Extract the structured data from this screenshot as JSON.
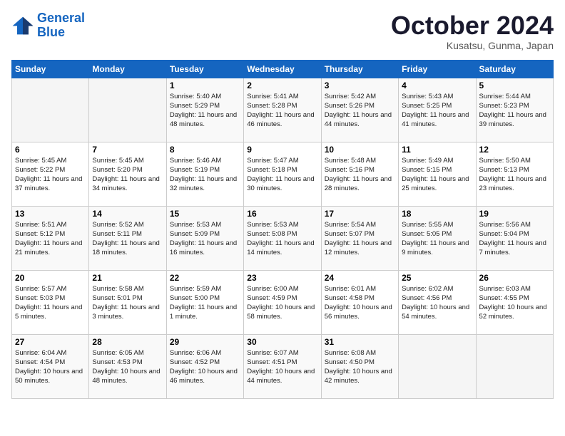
{
  "header": {
    "logo_line1": "General",
    "logo_line2": "Blue",
    "month": "October 2024",
    "location": "Kusatsu, Gunma, Japan"
  },
  "weekdays": [
    "Sunday",
    "Monday",
    "Tuesday",
    "Wednesday",
    "Thursday",
    "Friday",
    "Saturday"
  ],
  "weeks": [
    [
      {
        "day": "",
        "info": ""
      },
      {
        "day": "",
        "info": ""
      },
      {
        "day": "1",
        "info": "Sunrise: 5:40 AM\nSunset: 5:29 PM\nDaylight: 11 hours and 48 minutes."
      },
      {
        "day": "2",
        "info": "Sunrise: 5:41 AM\nSunset: 5:28 PM\nDaylight: 11 hours and 46 minutes."
      },
      {
        "day": "3",
        "info": "Sunrise: 5:42 AM\nSunset: 5:26 PM\nDaylight: 11 hours and 44 minutes."
      },
      {
        "day": "4",
        "info": "Sunrise: 5:43 AM\nSunset: 5:25 PM\nDaylight: 11 hours and 41 minutes."
      },
      {
        "day": "5",
        "info": "Sunrise: 5:44 AM\nSunset: 5:23 PM\nDaylight: 11 hours and 39 minutes."
      }
    ],
    [
      {
        "day": "6",
        "info": "Sunrise: 5:45 AM\nSunset: 5:22 PM\nDaylight: 11 hours and 37 minutes."
      },
      {
        "day": "7",
        "info": "Sunrise: 5:45 AM\nSunset: 5:20 PM\nDaylight: 11 hours and 34 minutes."
      },
      {
        "day": "8",
        "info": "Sunrise: 5:46 AM\nSunset: 5:19 PM\nDaylight: 11 hours and 32 minutes."
      },
      {
        "day": "9",
        "info": "Sunrise: 5:47 AM\nSunset: 5:18 PM\nDaylight: 11 hours and 30 minutes."
      },
      {
        "day": "10",
        "info": "Sunrise: 5:48 AM\nSunset: 5:16 PM\nDaylight: 11 hours and 28 minutes."
      },
      {
        "day": "11",
        "info": "Sunrise: 5:49 AM\nSunset: 5:15 PM\nDaylight: 11 hours and 25 minutes."
      },
      {
        "day": "12",
        "info": "Sunrise: 5:50 AM\nSunset: 5:13 PM\nDaylight: 11 hours and 23 minutes."
      }
    ],
    [
      {
        "day": "13",
        "info": "Sunrise: 5:51 AM\nSunset: 5:12 PM\nDaylight: 11 hours and 21 minutes."
      },
      {
        "day": "14",
        "info": "Sunrise: 5:52 AM\nSunset: 5:11 PM\nDaylight: 11 hours and 18 minutes."
      },
      {
        "day": "15",
        "info": "Sunrise: 5:53 AM\nSunset: 5:09 PM\nDaylight: 11 hours and 16 minutes."
      },
      {
        "day": "16",
        "info": "Sunrise: 5:53 AM\nSunset: 5:08 PM\nDaylight: 11 hours and 14 minutes."
      },
      {
        "day": "17",
        "info": "Sunrise: 5:54 AM\nSunset: 5:07 PM\nDaylight: 11 hours and 12 minutes."
      },
      {
        "day": "18",
        "info": "Sunrise: 5:55 AM\nSunset: 5:05 PM\nDaylight: 11 hours and 9 minutes."
      },
      {
        "day": "19",
        "info": "Sunrise: 5:56 AM\nSunset: 5:04 PM\nDaylight: 11 hours and 7 minutes."
      }
    ],
    [
      {
        "day": "20",
        "info": "Sunrise: 5:57 AM\nSunset: 5:03 PM\nDaylight: 11 hours and 5 minutes."
      },
      {
        "day": "21",
        "info": "Sunrise: 5:58 AM\nSunset: 5:01 PM\nDaylight: 11 hours and 3 minutes."
      },
      {
        "day": "22",
        "info": "Sunrise: 5:59 AM\nSunset: 5:00 PM\nDaylight: 11 hours and 1 minute."
      },
      {
        "day": "23",
        "info": "Sunrise: 6:00 AM\nSunset: 4:59 PM\nDaylight: 10 hours and 58 minutes."
      },
      {
        "day": "24",
        "info": "Sunrise: 6:01 AM\nSunset: 4:58 PM\nDaylight: 10 hours and 56 minutes."
      },
      {
        "day": "25",
        "info": "Sunrise: 6:02 AM\nSunset: 4:56 PM\nDaylight: 10 hours and 54 minutes."
      },
      {
        "day": "26",
        "info": "Sunrise: 6:03 AM\nSunset: 4:55 PM\nDaylight: 10 hours and 52 minutes."
      }
    ],
    [
      {
        "day": "27",
        "info": "Sunrise: 6:04 AM\nSunset: 4:54 PM\nDaylight: 10 hours and 50 minutes."
      },
      {
        "day": "28",
        "info": "Sunrise: 6:05 AM\nSunset: 4:53 PM\nDaylight: 10 hours and 48 minutes."
      },
      {
        "day": "29",
        "info": "Sunrise: 6:06 AM\nSunset: 4:52 PM\nDaylight: 10 hours and 46 minutes."
      },
      {
        "day": "30",
        "info": "Sunrise: 6:07 AM\nSunset: 4:51 PM\nDaylight: 10 hours and 44 minutes."
      },
      {
        "day": "31",
        "info": "Sunrise: 6:08 AM\nSunset: 4:50 PM\nDaylight: 10 hours and 42 minutes."
      },
      {
        "day": "",
        "info": ""
      },
      {
        "day": "",
        "info": ""
      }
    ]
  ]
}
